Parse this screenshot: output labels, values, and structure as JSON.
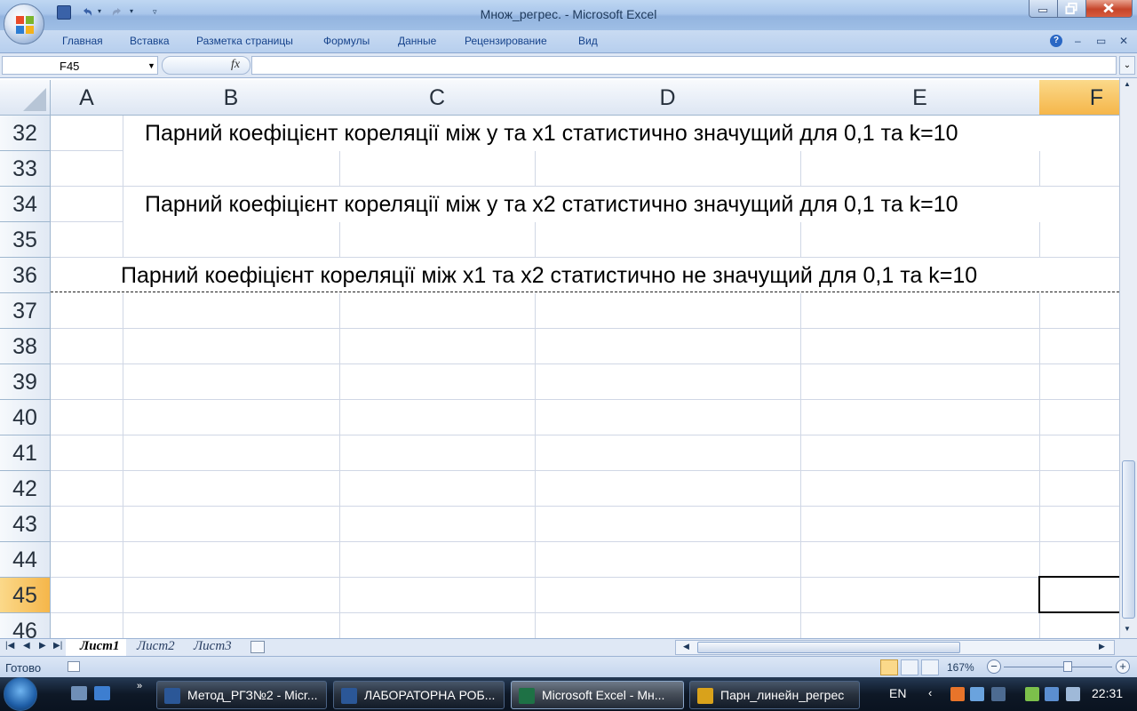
{
  "window": {
    "title": "Множ_регрес. - Microsoft Excel"
  },
  "ribbon": {
    "tabs": [
      "Главная",
      "Вставка",
      "Разметка страницы",
      "Формулы",
      "Данные",
      "Рецензирование",
      "Вид"
    ]
  },
  "formula_bar": {
    "name_box": "F45",
    "fx_label": "fx",
    "formula": ""
  },
  "sheet": {
    "columns": [
      "A",
      "B",
      "C",
      "D",
      "E",
      "F"
    ],
    "selected_column": "F",
    "rows": [
      "32",
      "33",
      "34",
      "35",
      "36",
      "37",
      "38",
      "39",
      "40",
      "41",
      "42",
      "43",
      "44",
      "45",
      "46"
    ],
    "selected_row": "45",
    "active_cell": "F45",
    "cells": {
      "r32": "Парний коефіцієнт кореляції між у та х1 статистично значущий для 0,1 та k=10",
      "r34": "Парний коефіцієнт кореляції між у та х2 статистично значущий для 0,1 та k=10",
      "r36": "Парний коефіцієнт кореляції між х1 та х2 статистично не значущий для 0,1 та k=10"
    }
  },
  "sheet_tabs": {
    "items": [
      "Лист1",
      "Лист2",
      "Лист3"
    ],
    "active": "Лист1"
  },
  "status_bar": {
    "status": "Готово",
    "zoom": "167%"
  },
  "taskbar": {
    "tasks": [
      {
        "label": "Метод_РГЗ№2 - Micr...",
        "icon": "word-icon",
        "color": "#2b5797"
      },
      {
        "label": "ЛАБОРАТОРНА РОБ...",
        "icon": "word-icon",
        "color": "#2b5797"
      },
      {
        "label": "Microsoft Excel - Мн...",
        "icon": "excel-icon",
        "color": "#1e7145"
      },
      {
        "label": "Парн_линейн_регрес",
        "icon": "folder-icon",
        "color": "#d9a21b"
      }
    ],
    "active_task": 2,
    "language": "EN",
    "clock": "22:31"
  }
}
